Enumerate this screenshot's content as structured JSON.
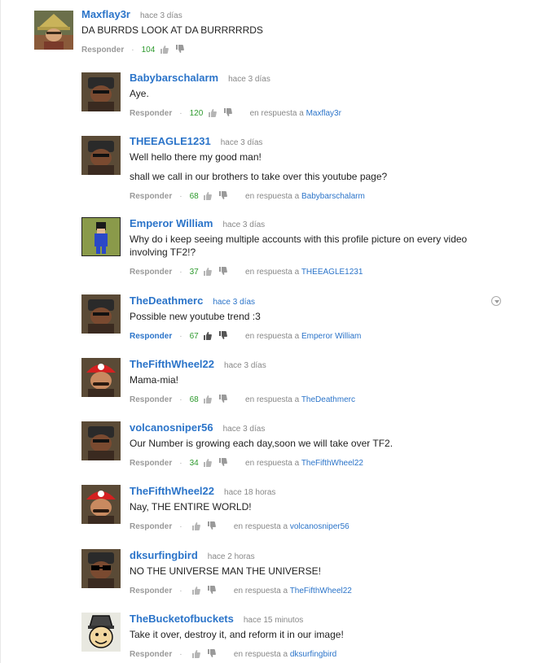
{
  "ui": {
    "reply_label": "Responder",
    "reply_to_prefix": "en respuesta a"
  },
  "comments": [
    {
      "author": "Maxflay3r",
      "time": "hace 3 días",
      "text": [
        "DA BURRDS LOOK AT DA BURRRRRDS"
      ],
      "likes": "104",
      "reply_to": "",
      "avatar": "hat-avatar"
    },
    {
      "author": "Babybarschalarm",
      "time": "hace 3 días",
      "text": [
        "Aye."
      ],
      "likes": "120",
      "reply_to": "Maxflay3r",
      "avatar": "demoman-avatar"
    },
    {
      "author": "THEEAGLE1231",
      "time": "hace 3 días",
      "text": [
        "Well hello there my good man!",
        "shall we call in our brothers to take over this youtube page?"
      ],
      "likes": "68",
      "reply_to": "Babybarschalarm",
      "avatar": "demoman-avatar"
    },
    {
      "author": "Emperor William",
      "time": "hace 3 días",
      "text": [
        "Why do i keep seeing multiple accounts with this profile picture on every video involving TF2!?"
      ],
      "likes": "37",
      "reply_to": "THEEAGLE1231",
      "avatar": "pixel-character-avatar"
    },
    {
      "author": "TheDeathmerc",
      "time": "hace 3 días",
      "text": [
        "Possible new youtube trend :3"
      ],
      "likes": "67",
      "reply_to": "Emperor William",
      "avatar": "demoman-avatar"
    },
    {
      "author": "TheFifthWheel22",
      "time": "hace 3 días",
      "text": [
        "Mama-mia!"
      ],
      "likes": "68",
      "reply_to": "TheDeathmerc",
      "avatar": "mario-hat-avatar"
    },
    {
      "author": "volcanosniper56",
      "time": "hace 3 días",
      "text": [
        "Our Number is growing each day,soon we will take over TF2."
      ],
      "likes": "34",
      "reply_to": "TheFifthWheel22",
      "avatar": "demoman-avatar"
    },
    {
      "author": "TheFifthWheel22",
      "time": "hace 18 horas",
      "text": [
        "Nay, THE ENTIRE WORLD!"
      ],
      "likes": "",
      "reply_to": "volcanosniper56",
      "avatar": "mario-hat-avatar"
    },
    {
      "author": "dksurfingbird",
      "time": "hace 2 horas",
      "text": [
        "NO THE UNIVERSE MAN THE UNIVERSE!"
      ],
      "likes": "",
      "reply_to": "TheFifthWheel22",
      "avatar": "sunglasses-avatar"
    },
    {
      "author": "TheBucketofbuckets",
      "time": "hace 15 minutos",
      "text": [
        "Take it over, destroy it, and reform it in our image!"
      ],
      "likes": "",
      "reply_to": "dksurfingbird",
      "avatar": "cartoon-face-avatar"
    }
  ],
  "colors": {
    "link": "#2b74c9",
    "likes": "#2e9a2e",
    "meta": "#888888"
  }
}
